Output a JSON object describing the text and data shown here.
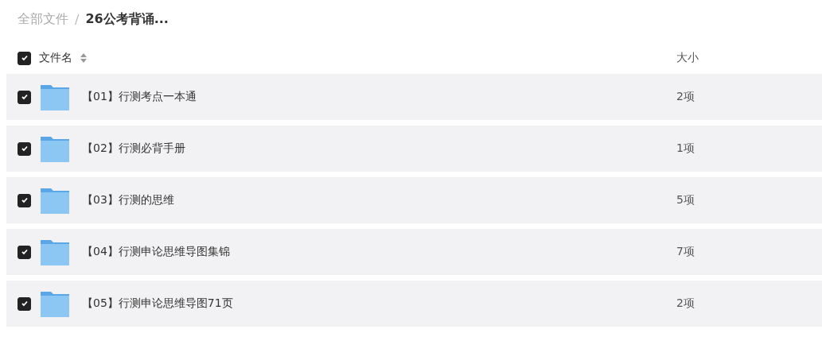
{
  "breadcrumb": {
    "root": "全部文件",
    "separator": "/",
    "current": "26公考背诵..."
  },
  "table": {
    "select_all_checked": true,
    "columns": [
      {
        "label": "文件名",
        "sortable": true
      },
      {
        "label": "大小",
        "sortable": false
      }
    ],
    "rows": [
      {
        "name": "【01】行测考点一本通",
        "size": "2项",
        "checked": true
      },
      {
        "name": "【02】行测必背手册",
        "size": "1项",
        "checked": true
      },
      {
        "name": "【03】行测的思维",
        "size": "5项",
        "checked": true
      },
      {
        "name": "【04】行测申论思维导图集锦",
        "size": "7项",
        "checked": true
      },
      {
        "name": "【05】行测申论思维导图71页",
        "size": "2项",
        "checked": true
      }
    ]
  }
}
